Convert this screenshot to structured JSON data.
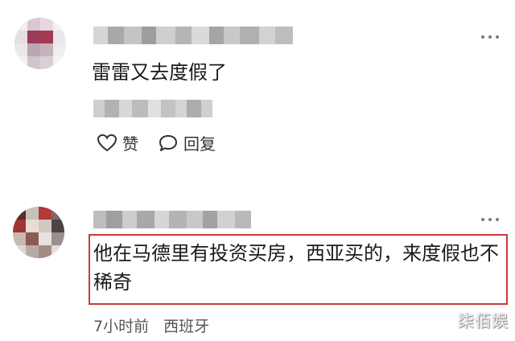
{
  "comments": [
    {
      "text": "雷雷又去度假了",
      "actions": {
        "like_label": "赞",
        "reply_label": "回复"
      }
    },
    {
      "text": "他在马德里有投资买房，西亚买的，来度假也不稀奇",
      "time": "7小时前",
      "location": "西班牙"
    }
  ],
  "watermark": "柒佰娱",
  "icons": {
    "like": "heart-outline-icon",
    "reply": "speech-bubble-icon",
    "more": "more-dots-icon"
  },
  "colors": {
    "highlight_border": "#c93a3a"
  }
}
